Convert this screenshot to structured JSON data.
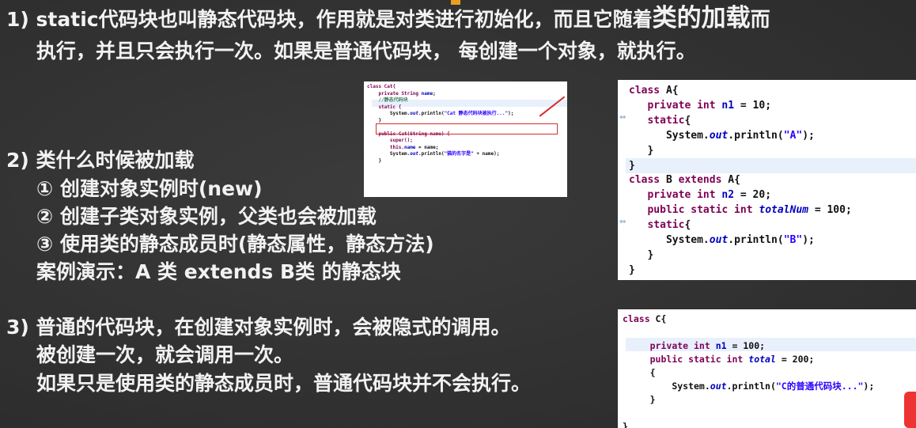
{
  "accent_color": "#e8a020",
  "point1": {
    "num": "1)",
    "line1_pre": "static代码块也叫静态代码块，作用就是对类进行初始化，而且它随着",
    "line1_big": "类的加载",
    "line1_post": "而",
    "line2": "执行，并且只会执行一次。如果是普通代码块， 每创建一个对象，就执行。"
  },
  "point2": {
    "num": "2)",
    "title": "类什么时候被加载",
    "items": [
      "① 创建对象实例时(new)",
      "② 创建子类对象实例，父类也会被加载",
      "③ 使用类的静态成员时(静态属性，静态方法)"
    ],
    "demo": "案例演示：A 类 extends  B类 的静态块"
  },
  "point3": {
    "num": "3)",
    "lines": [
      "普通的代码块，在创建对象实例时，会被隐式的调用。",
      "被创建一次，就会调用一次。",
      "如果只是使用类的静态成员时，普通代码块并不会执行。"
    ]
  },
  "code_cat": {
    "l1": "class Cat{",
    "l2_a": "private String",
    "l2_b": "name",
    "l2_c": ";",
    "l3": "//静态代码块",
    "l4": "static {",
    "l5_a": "System.",
    "l5_b": "out",
    "l5_c": ".println(",
    "l5_d": "\"Cat 静态代码块被执行...\"",
    "l5_e": ");",
    "l6": "}",
    "l7_a": "public Cat(String name) {",
    "l8": "super();",
    "l9_a": "this.",
    "l9_b": "name",
    "l9_c": " = name;",
    "l10_a": "System.",
    "l10_b": "out",
    "l10_c": ".println(",
    "l10_d": "\"猫的名字是\"",
    "l10_e": " + name);",
    "l11": "}"
  },
  "code_ab": {
    "a1_kw": "class",
    "a1_rest": " A{",
    "a2_kw": "private int",
    "a2_fld": "n1",
    "a2_rest": " = 10;",
    "a3_kw": "static",
    "a3_rest": "{",
    "a4_a": "System.",
    "a4_b": "out",
    "a4_c": ".println(",
    "a4_d": "\"A\"",
    "a4_e": ");",
    "a5": "}",
    "a6": "}",
    "b1_kw": "class",
    "b1_mid": " B ",
    "b1_kw2": "extends",
    "b1_rest": " A{",
    "b2_kw": "private int",
    "b2_fld": "n2",
    "b2_rest": " = 20;",
    "b3_kw": "public static int",
    "b3_fld": "totalNum",
    "b3_rest": " = 100;",
    "b4_kw": "static",
    "b4_rest": "{",
    "b5_a": "System.",
    "b5_b": "out",
    "b5_c": ".println(",
    "b5_d": "\"B\"",
    "b5_e": ");",
    "b6": "}",
    "b7": "}"
  },
  "code_c": {
    "c1_kw": "class",
    "c1_rest": " C{",
    "c2_kw": "private int",
    "c2_fld": "n1",
    "c2_rest": " = 100;",
    "c3_kw": "public static int",
    "c3_fld": "total",
    "c3_rest": " = 200;",
    "c4": "{",
    "c5_a": "System.",
    "c5_b": "out",
    "c5_c": ".println(",
    "c5_d": "\"C的普通代码块...\"",
    "c5_e": ");",
    "c6": "}",
    "c7": "}"
  }
}
